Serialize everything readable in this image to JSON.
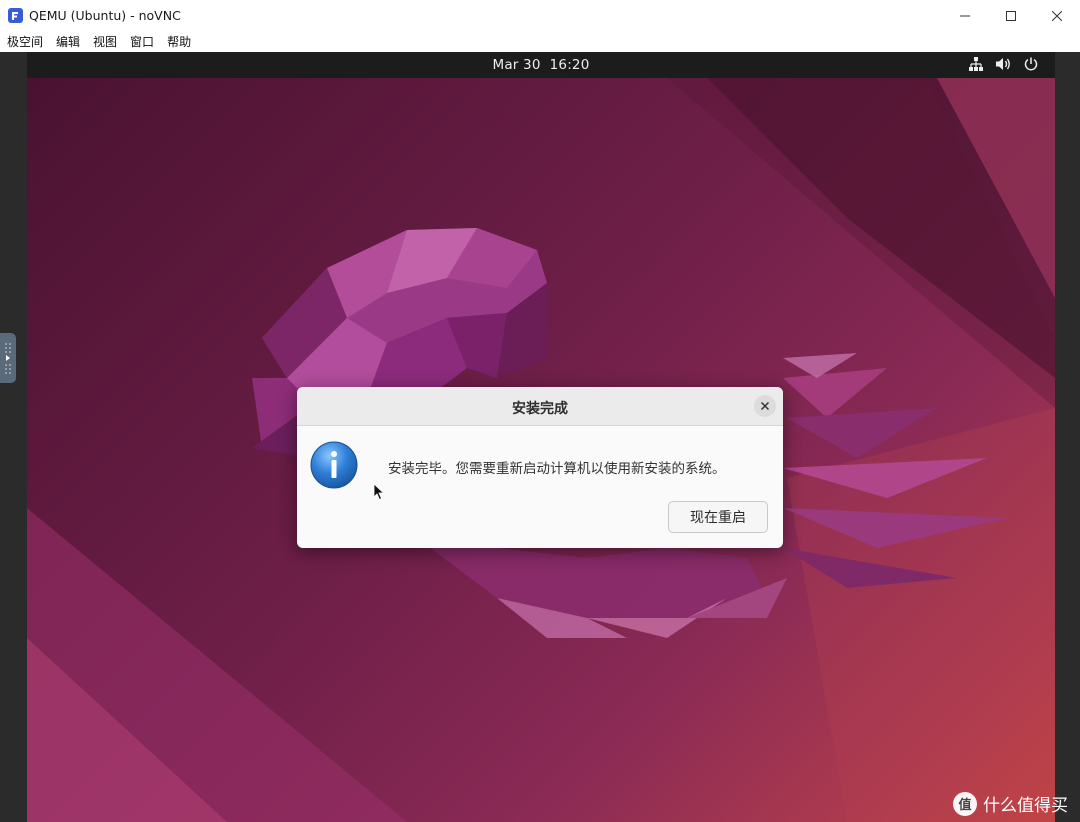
{
  "window": {
    "title": "QEMU (Ubuntu) - noVNC",
    "icon": "novnc-app-icon",
    "controls": [
      "minimize-icon",
      "maximize-icon",
      "close-icon"
    ]
  },
  "menubar": {
    "items": [
      "极空间",
      "编辑",
      "视图",
      "窗口",
      "帮助"
    ]
  },
  "ubuntu_topbar": {
    "date": "Mar 30",
    "time": "16:20",
    "tray_icons": [
      "network-icon",
      "volume-icon",
      "power-icon"
    ]
  },
  "dialog": {
    "title": "安装完成",
    "message": "安装完毕。您需要重新启动计算机以使用新安装的系统。",
    "button": "现在重启",
    "icon": "info-icon"
  },
  "watermark": {
    "text": "什么值得买",
    "logo_char": "值"
  },
  "colors": {
    "accent": "#3a5bd9",
    "wallpaper_dark": "#4a1230",
    "wallpaper_light": "#c9463f",
    "info_blue": "#2f7fd6"
  }
}
